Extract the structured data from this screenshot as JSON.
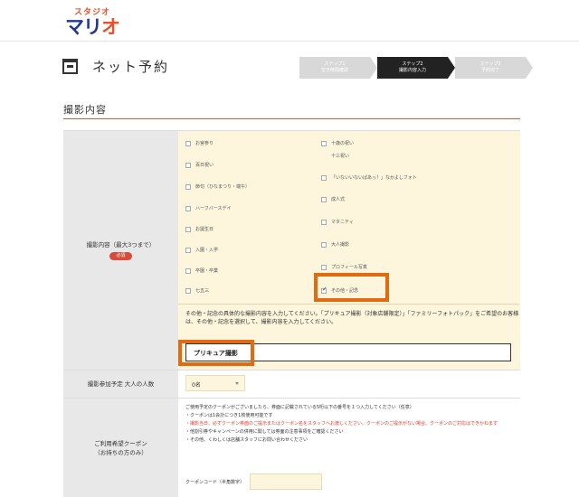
{
  "header": {
    "logo_small": "スタジオ",
    "logo_main": "マリ",
    "logo_main_o": "オ"
  },
  "page_title": "ネット予約",
  "steps": [
    {
      "label": "ステップ1",
      "sub": "空き時間確認"
    },
    {
      "label": "ステップ2",
      "sub": "撮影内容入力"
    },
    {
      "label": "ステップ3",
      "sub": "予約完了"
    }
  ],
  "section_title": "撮影内容",
  "shoot_content": {
    "label": "撮影内容（最大3つまで）",
    "required": "必須",
    "left_options": [
      "お宮参り",
      "百日祝い",
      "節句（ひなまつり・端午）",
      "ハーフバースデイ",
      "お誕生日",
      "入園・入学",
      "卒園・卒業",
      "七五三"
    ],
    "right_options": [
      "十歳の祝い",
      "十三祝い",
      "「いないいないばあっ！」なかよしフォト",
      "成人式",
      "マタニティ",
      "大人撮影",
      "プロフィール写真",
      "その他・記念"
    ],
    "checked": "その他・記念",
    "other_note": "その他・記念の具体的な撮影内容を入力してください。「プリキュア撮影（対象店舗限定）」「ファミリーフォトパック」をご希望のお客様は、その他・記念を選択して、撮影内容を入力してください。",
    "other_value": "プリキュア撮影"
  },
  "adults": {
    "label": "撮影参加予定 大人の人数",
    "value": "0名"
  },
  "coupon": {
    "label_line1": "ご利用希望クーポン",
    "label_line2": "（お持ちの方のみ）",
    "lines": [
      "ご使用予定のクーポンがございましたら、券面に記載されている5桁以下の番号を１つ入力してください（任意）",
      "・クーポンは1会計につき1枚使用可能です",
      "・撮影当日、必ずクーポン券面のご提示またはクーポン名をスタッフへお渡しください。クーポンのご提示がない場合、クーポンのご対応はできかねます",
      "・他割引券やキャンペーンの併用に関しては券面の注意事項をご確認ください",
      "・その他、くわしくは店舗スタッフにお問い合わせください"
    ],
    "code_label": "クーポンコード（半角数字）",
    "code_value": ""
  }
}
